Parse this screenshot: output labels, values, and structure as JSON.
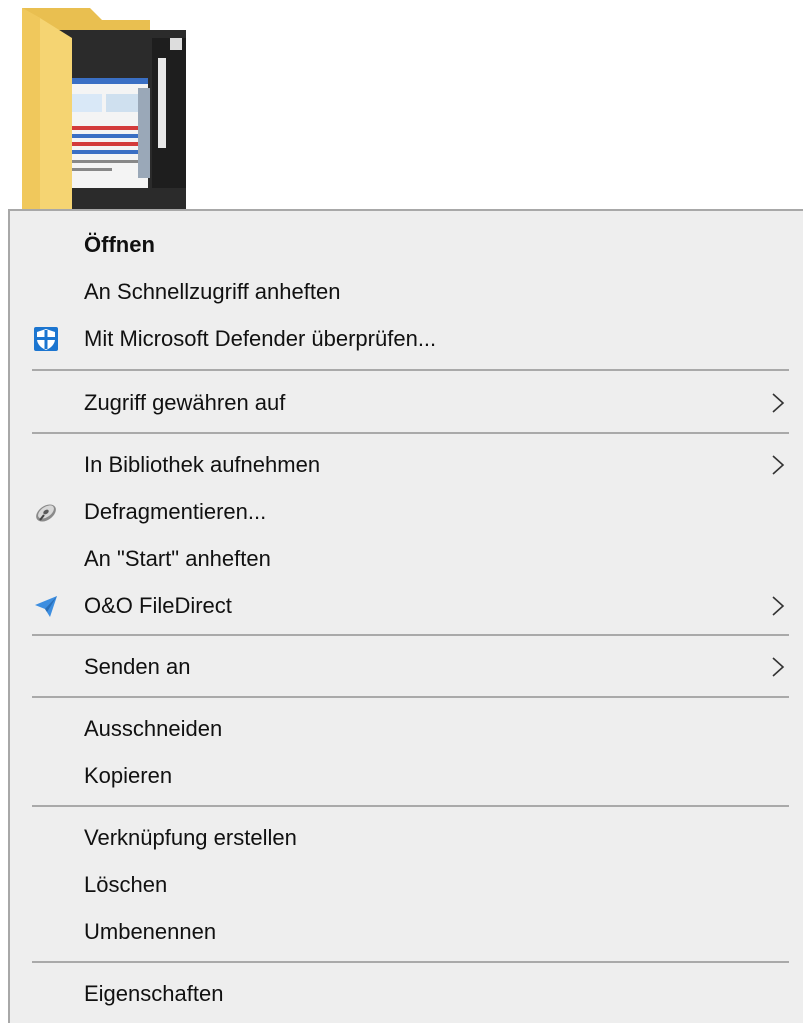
{
  "menu": {
    "open": "Öffnen",
    "pin_quick_access": "An Schnellzugriff anheften",
    "defender_scan": "Mit Microsoft Defender überprüfen...",
    "give_access": "Zugriff gewähren auf",
    "include_library": "In Bibliothek aufnehmen",
    "defragment": "Defragmentieren...",
    "pin_start": "An \"Start\" anheften",
    "filedirect": "O&O FileDirect",
    "send_to": "Senden an",
    "cut": "Ausschneiden",
    "copy": "Kopieren",
    "create_shortcut": "Verknüpfung erstellen",
    "delete": "Löschen",
    "rename": "Umbenennen",
    "properties": "Eigenschaften"
  },
  "icons": {
    "defender": "shield-icon",
    "defragment": "defragment-icon",
    "filedirect": "paper-plane-icon",
    "submenu": "chevron-right-icon"
  },
  "colors": {
    "menu_background": "#eeeeee",
    "folder_yellow": "#f5d472",
    "defender_blue": "#1b75d0",
    "filedirect_blue": "#3d8ee0"
  }
}
